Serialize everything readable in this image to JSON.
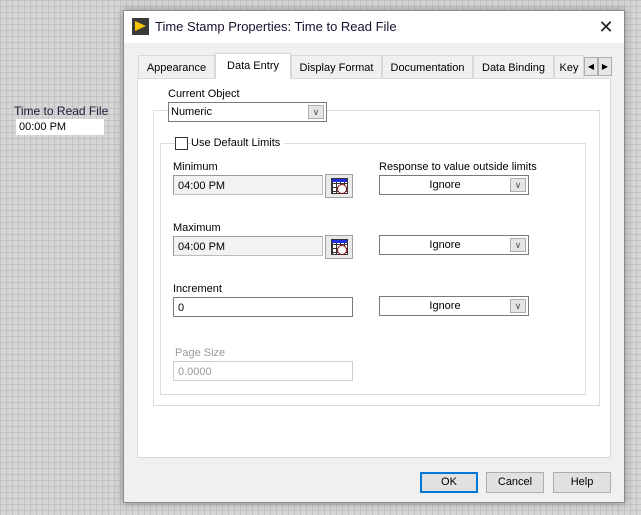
{
  "front_panel": {
    "label": "Time to Read File",
    "value": "00:00 PM"
  },
  "dialog": {
    "title": "Time Stamp Properties: Time to Read File",
    "tabs": [
      "Appearance",
      "Data Entry",
      "Display Format",
      "Documentation",
      "Data Binding",
      "Key"
    ],
    "active_tab": "Data Entry",
    "current_object_label": "Current Object",
    "current_object_value": "Numeric",
    "use_default_limits_label": "Use Default Limits",
    "use_default_limits_checked": false,
    "minimum_label": "Minimum",
    "minimum_value": "04:00 PM",
    "maximum_label": "Maximum",
    "maximum_value": "04:00 PM",
    "increment_label": "Increment",
    "increment_value": "0",
    "page_size_label": "Page Size",
    "page_size_value": "0.0000",
    "response_label": "Response to value outside limits",
    "response_min": "Ignore",
    "response_max": "Ignore",
    "response_inc": "Ignore",
    "buttons": {
      "ok": "OK",
      "cancel": "Cancel",
      "help": "Help"
    }
  },
  "colors": {
    "accent": "#0078d7",
    "logo": "#f5c400"
  }
}
